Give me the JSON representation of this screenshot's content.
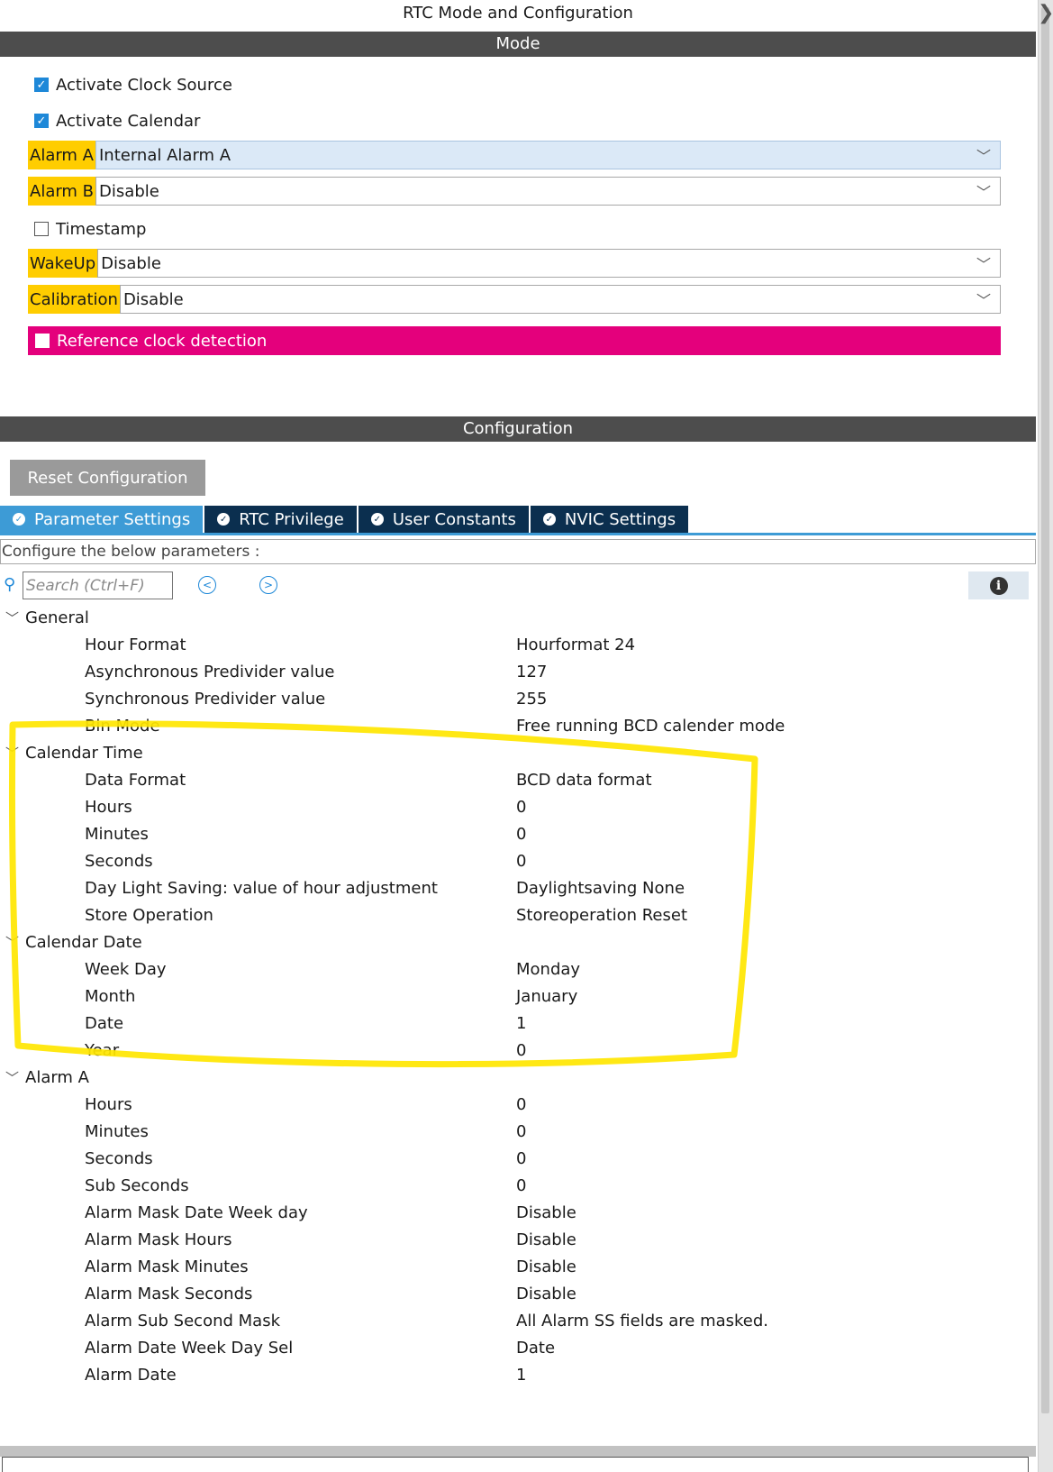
{
  "window_title": "RTC Mode and Configuration",
  "mode": {
    "header": "Mode",
    "checkboxes": [
      {
        "label": "Activate Clock Source",
        "checked": true
      },
      {
        "label": "Activate Calendar",
        "checked": true
      }
    ],
    "alarm_a": {
      "label": "Alarm A",
      "value": "Internal Alarm A"
    },
    "alarm_b": {
      "label": "Alarm B",
      "value": "Disable"
    },
    "timestamp": {
      "label": "Timestamp",
      "checked": false
    },
    "wakeup": {
      "label": "WakeUp",
      "value": "Disable"
    },
    "calibration": {
      "label": "Calibration",
      "value": "Disable"
    },
    "reference_clock": {
      "label": "Reference clock detection",
      "checked": false
    }
  },
  "configuration": {
    "header": "Configuration",
    "reset_label": "Reset Configuration",
    "tabs": [
      {
        "label": "Parameter Settings",
        "active": true
      },
      {
        "label": "RTC Privilege",
        "active": false
      },
      {
        "label": "User Constants",
        "active": false
      },
      {
        "label": "NVIC Settings",
        "active": false
      }
    ],
    "instructions": "Configure the below parameters :",
    "search_placeholder": "Search (Ctrl+F)",
    "groups": {
      "general": {
        "title": "General",
        "params": [
          {
            "name": "Hour Format",
            "value": "Hourformat 24"
          },
          {
            "name": "Asynchronous Predivider value",
            "value": "127"
          },
          {
            "name": "Synchronous Predivider value",
            "value": "255"
          },
          {
            "name": "Bin Mode",
            "value": "Free running BCD calender mode"
          }
        ]
      },
      "calendar_time": {
        "title": "Calendar Time",
        "params": [
          {
            "name": "Data Format",
            "value": "BCD data format"
          },
          {
            "name": "Hours",
            "value": "0"
          },
          {
            "name": "Minutes",
            "value": "0"
          },
          {
            "name": "Seconds",
            "value": "0"
          },
          {
            "name": "Day Light Saving: value of hour adjustment",
            "value": "Daylightsaving None"
          },
          {
            "name": "Store Operation",
            "value": "Storeoperation Reset"
          }
        ]
      },
      "calendar_date": {
        "title": "Calendar Date",
        "params": [
          {
            "name": "Week Day",
            "value": "Monday"
          },
          {
            "name": "Month",
            "value": "January"
          },
          {
            "name": "Date",
            "value": "1"
          },
          {
            "name": "Year",
            "value": "0"
          }
        ]
      },
      "alarm_a": {
        "title": "Alarm A",
        "params": [
          {
            "name": "Hours",
            "value": "0"
          },
          {
            "name": "Minutes",
            "value": "0"
          },
          {
            "name": "Seconds",
            "value": "0"
          },
          {
            "name": "Sub Seconds",
            "value": "0"
          },
          {
            "name": "Alarm Mask Date Week day",
            "value": "Disable"
          },
          {
            "name": "Alarm Mask Hours",
            "value": "Disable"
          },
          {
            "name": "Alarm Mask Minutes",
            "value": "Disable"
          },
          {
            "name": "Alarm Mask Seconds",
            "value": "Disable"
          },
          {
            "name": "Alarm Sub Second Mask",
            "value": "All Alarm SS fields are masked."
          },
          {
            "name": "Alarm Date Week Day Sel",
            "value": "Date"
          },
          {
            "name": "Alarm Date",
            "value": "1"
          }
        ]
      }
    }
  },
  "colors": {
    "section_bar": "#4d4d4d",
    "label_highlight": "#ffcd00",
    "reference_row": "#e4007c",
    "tab_active": "#3d9bd6",
    "tab_inactive": "#0b2f4f",
    "annotation_marker": "#ffe600"
  }
}
